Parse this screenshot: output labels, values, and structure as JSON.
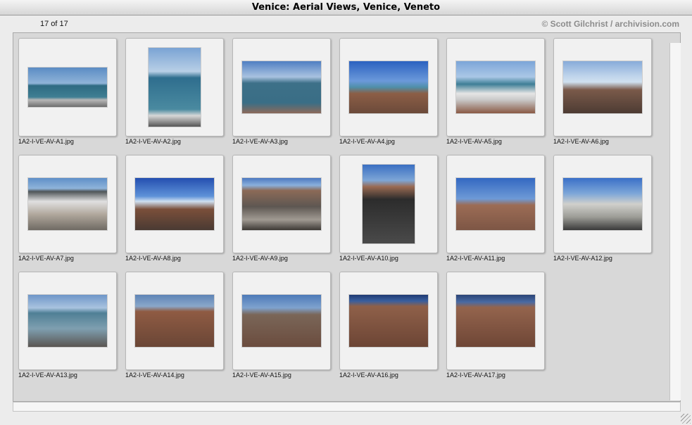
{
  "window": {
    "title": "Venice: Aerial Views, Venice, Veneto"
  },
  "header": {
    "count": "17 of 17",
    "copyright": "© Scott Gilchrist / archivision.com"
  },
  "thumbnails": [
    {
      "filename": "1A2-I-VE-AV-A1.jpg"
    },
    {
      "filename": "1A2-I-VE-AV-A2.jpg"
    },
    {
      "filename": "1A2-I-VE-AV-A3.jpg"
    },
    {
      "filename": "1A2-I-VE-AV-A4.jpg"
    },
    {
      "filename": "1A2-I-VE-AV-A5.jpg"
    },
    {
      "filename": "1A2-I-VE-AV-A6.jpg"
    },
    {
      "filename": "1A2-I-VE-AV-A7.jpg"
    },
    {
      "filename": "1A2-I-VE-AV-A8.jpg"
    },
    {
      "filename": "1A2-I-VE-AV-A9.jpg"
    },
    {
      "filename": "1A2-I-VE-AV-A10.jpg"
    },
    {
      "filename": "1A2-I-VE-AV-A11.jpg"
    },
    {
      "filename": "1A2-I-VE-AV-A12.jpg"
    },
    {
      "filename": "1A2-I-VE-AV-A13.jpg"
    },
    {
      "filename": "1A2-I-VE-AV-A14.jpg"
    },
    {
      "filename": "1A2-I-VE-AV-A15.jpg"
    },
    {
      "filename": "1A2-I-VE-AV-A16.jpg"
    },
    {
      "filename": "1A2-I-VE-AV-A17.jpg"
    }
  ]
}
